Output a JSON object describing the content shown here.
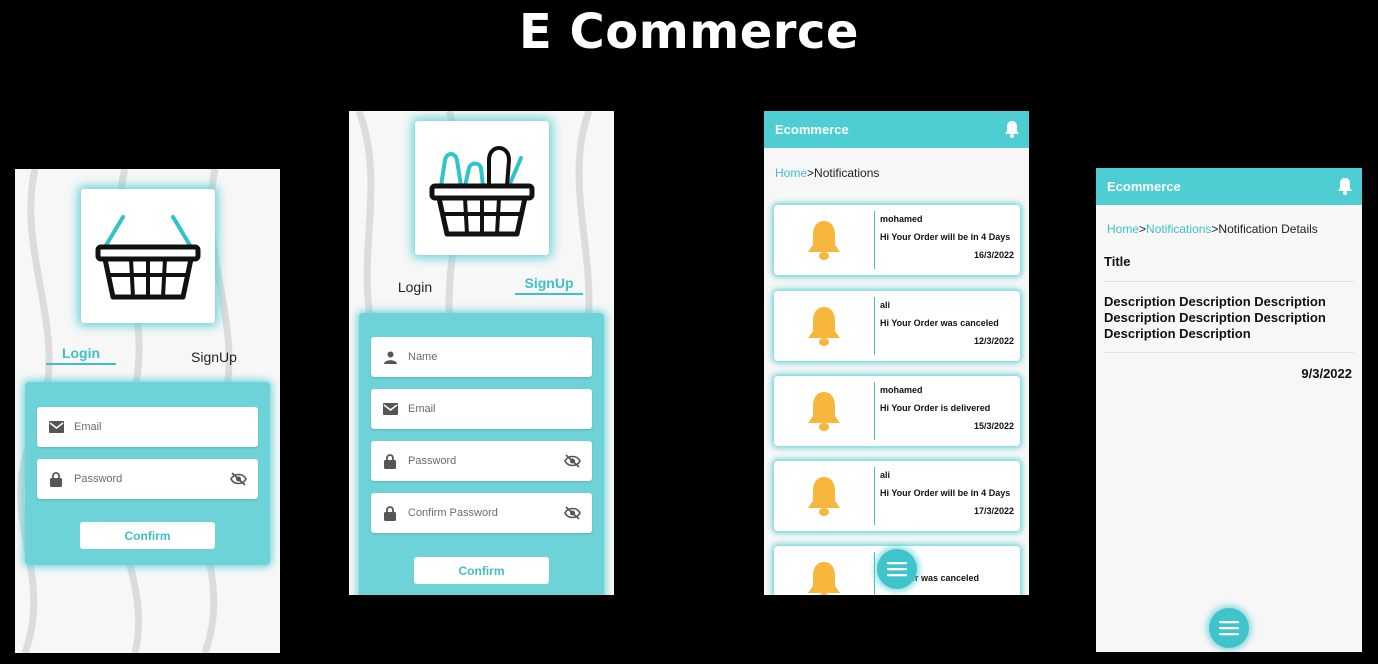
{
  "page_title": "E Commerce",
  "login_screen": {
    "tab_login": "Login",
    "tab_signup": "SignUp",
    "email_placeholder": "Email",
    "password_placeholder": "Password",
    "confirm_label": "Confirm"
  },
  "signup_screen": {
    "tab_login": "Login",
    "tab_signup": "SignUp",
    "name_placeholder": "Name",
    "email_placeholder": "Email",
    "password_placeholder": "Password",
    "confirm_password_placeholder": "Confirm Password",
    "confirm_label": "Confirm"
  },
  "notifications_screen": {
    "app_title": "Ecommerce",
    "breadcrumb_home": "Home",
    "breadcrumb_sep": ">",
    "breadcrumb_current": "Notifications",
    "notifications": [
      {
        "name": "mohamed",
        "message": "Hi Your Order will be in 4 Days",
        "date": "16/3/2022"
      },
      {
        "name": "ali",
        "message": "Hi Your Order was canceled",
        "date": "12/3/2022"
      },
      {
        "name": "mohamed",
        "message": "Hi Your Order is delivered",
        "date": "15/3/2022"
      },
      {
        "name": "ali",
        "message": "Hi Your Order will be in 4 Days",
        "date": "17/3/2022"
      },
      {
        "name": "",
        "message": "Order was canceled",
        "date": ""
      }
    ]
  },
  "details_screen": {
    "app_title": "Ecommerce",
    "breadcrumb_home": "Home",
    "breadcrumb_sep1": ">",
    "breadcrumb_mid": "Notifications",
    "breadcrumb_sep2": ">",
    "breadcrumb_current": "Notification Details",
    "title": "Title",
    "description": "Description Description Description Description Description Description Description Description",
    "date": "9/3/2022"
  },
  "colors": {
    "accent": "#4ecdd3",
    "panel": "#6dd3d8",
    "bell": "#f6b73c",
    "background": "#000000"
  },
  "icons": [
    "basket-icon",
    "basket-full-icon",
    "mail-icon",
    "lock-icon",
    "eye-off-icon",
    "person-icon",
    "bell-icon",
    "menu-icon"
  ]
}
